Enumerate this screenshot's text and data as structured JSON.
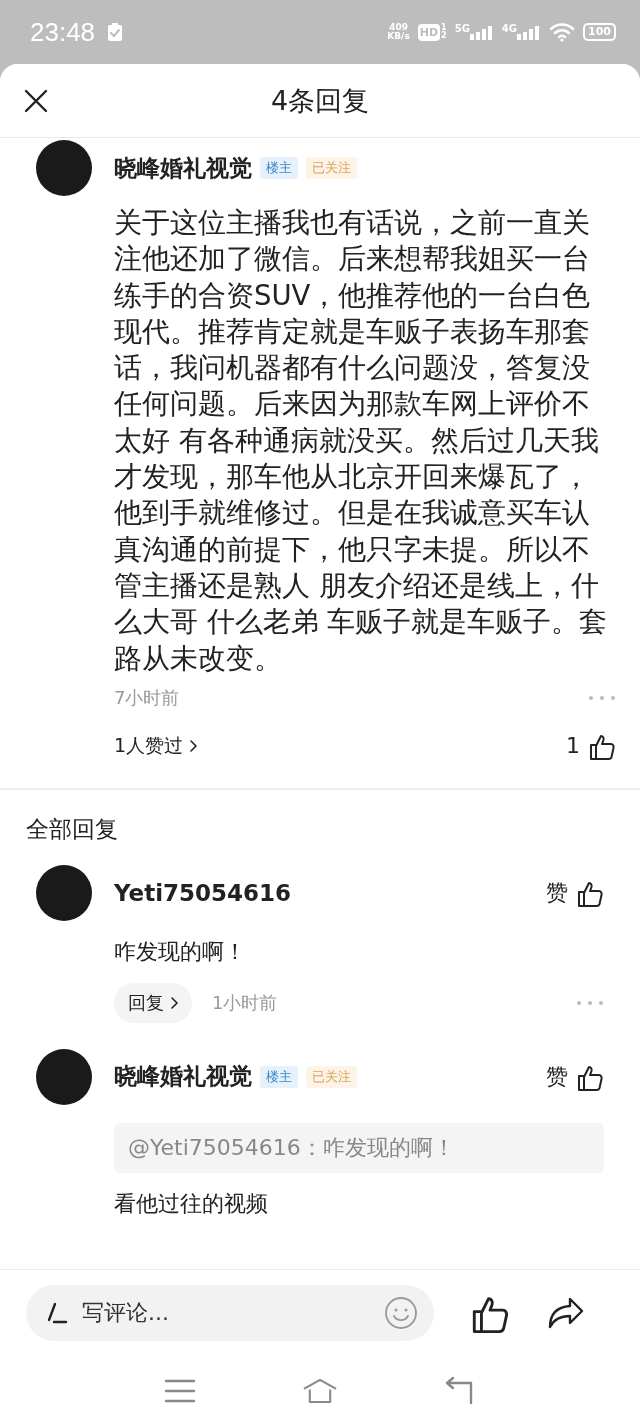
{
  "status_bar": {
    "time": "23:48",
    "net_speed": [
      "409",
      "KB/s"
    ],
    "hd": "HD",
    "hd_sub": [
      "1",
      "2"
    ],
    "signals": [
      {
        "label": "5G"
      },
      {
        "label": "4G"
      }
    ],
    "battery": "100"
  },
  "header": {
    "title": "4条回复"
  },
  "main_comment": {
    "author": "晓峰婚礼视觉",
    "badges": [
      {
        "kind": "owner",
        "label": "楼主"
      },
      {
        "kind": "following",
        "label": "已关注"
      }
    ],
    "text": "关于这位主播我也有话说，之前一直关注他还加了微信。后来想帮我姐买一台练手的合资SUV，他推荐他的一台白色现代。推荐肯定就是车贩子表扬车那套话，我问机器都有什么问题没，答复没任何问题。后来因为那款车网上评价不太好 有各种通病就没买。然后过几天我才发现，那车他从北京开回来爆瓦了，他到手就维修过。但是在我诚意买车认真沟通的前提下，他只字未提。所以不管主播还是熟人 朋友介绍还是线上，什么大哥 什么老弟 车贩子就是车贩子。套路从未改变。",
    "time": "7小时前",
    "likers": "1人赞过",
    "like_count": "1"
  },
  "section_title": "全部回复",
  "replies": [
    {
      "author": "Yeti75054616",
      "like_label": "赞",
      "text": "咋发现的啊！",
      "reply_button": "回复",
      "time": "1小时前"
    },
    {
      "author": "晓峰婚礼视觉",
      "badges": [
        {
          "kind": "owner",
          "label": "楼主"
        },
        {
          "kind": "following",
          "label": "已关注"
        }
      ],
      "like_label": "赞",
      "quote": "@Yeti75054616：咋发现的啊！",
      "text": "看他过往的视频"
    }
  ],
  "composer": {
    "placeholder": "写评论..."
  }
}
